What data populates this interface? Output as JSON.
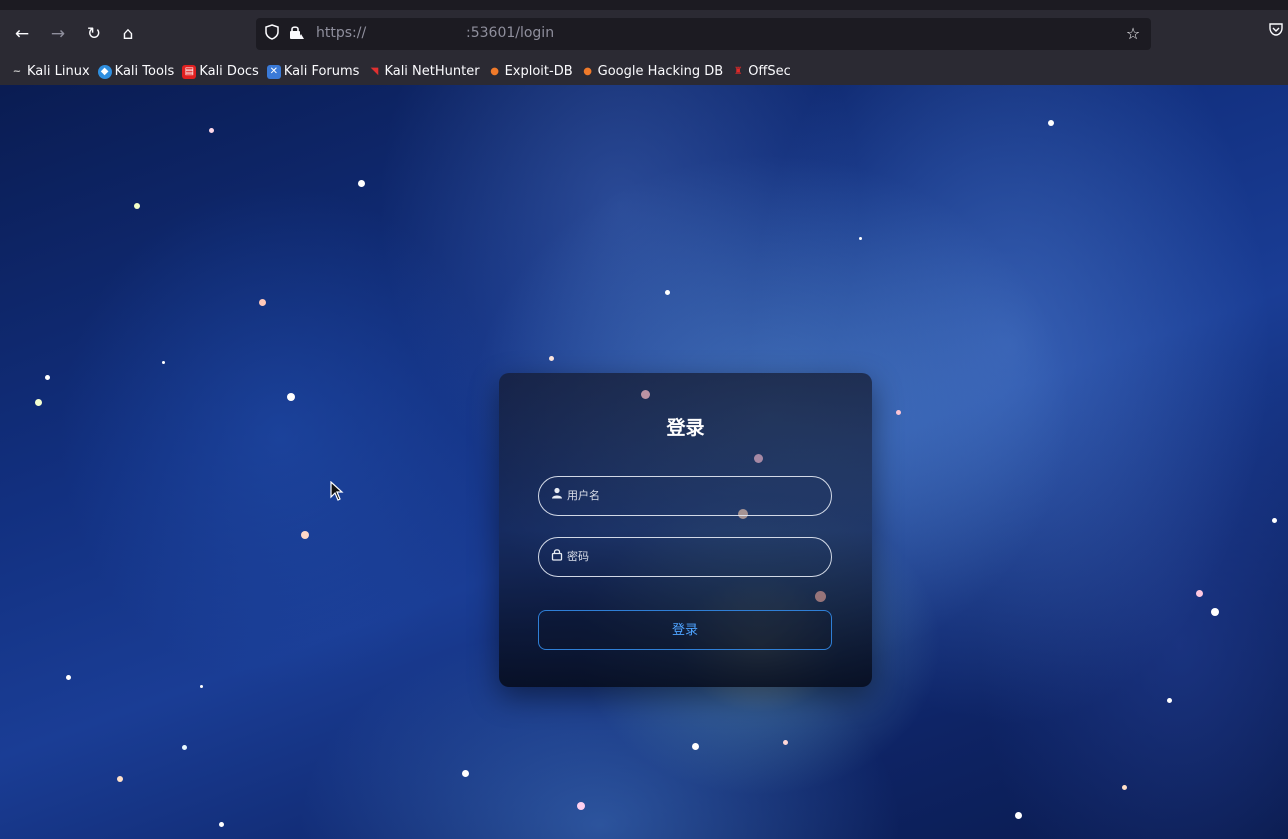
{
  "browser": {
    "nav": {
      "back_icon": "←",
      "forward_icon": "→",
      "reload_icon": "↻",
      "home_icon": "⌂"
    },
    "url": {
      "protocol": "https://",
      "rest": ":53601/login"
    },
    "bookmarks": [
      {
        "label": "Kali Linux",
        "icon": "kali-dragon-icon",
        "color": "#c8c8c8"
      },
      {
        "label": "Kali Tools",
        "icon": "kali-tools-icon",
        "color": "#2f8fe0"
      },
      {
        "label": "Kali Docs",
        "icon": "kali-docs-icon",
        "color": "#e02020"
      },
      {
        "label": "Kali Forums",
        "icon": "kali-forums-icon",
        "color": "#3a7ad8"
      },
      {
        "label": "Kali NetHunter",
        "icon": "nethunter-icon",
        "color": "#e03030"
      },
      {
        "label": "Exploit-DB",
        "icon": "exploit-db-icon",
        "color": "#f07a2a"
      },
      {
        "label": "Google Hacking DB",
        "icon": "ghdb-icon",
        "color": "#f07a2a"
      },
      {
        "label": "OffSec",
        "icon": "offsec-icon",
        "color": "#e02a2a"
      }
    ]
  },
  "login": {
    "title": "登录",
    "username_placeholder": "用户名",
    "password_placeholder": "密码",
    "submit_label": "登录",
    "colors": {
      "accent": "#4ea3ff",
      "border": "#2f7fd6"
    }
  }
}
